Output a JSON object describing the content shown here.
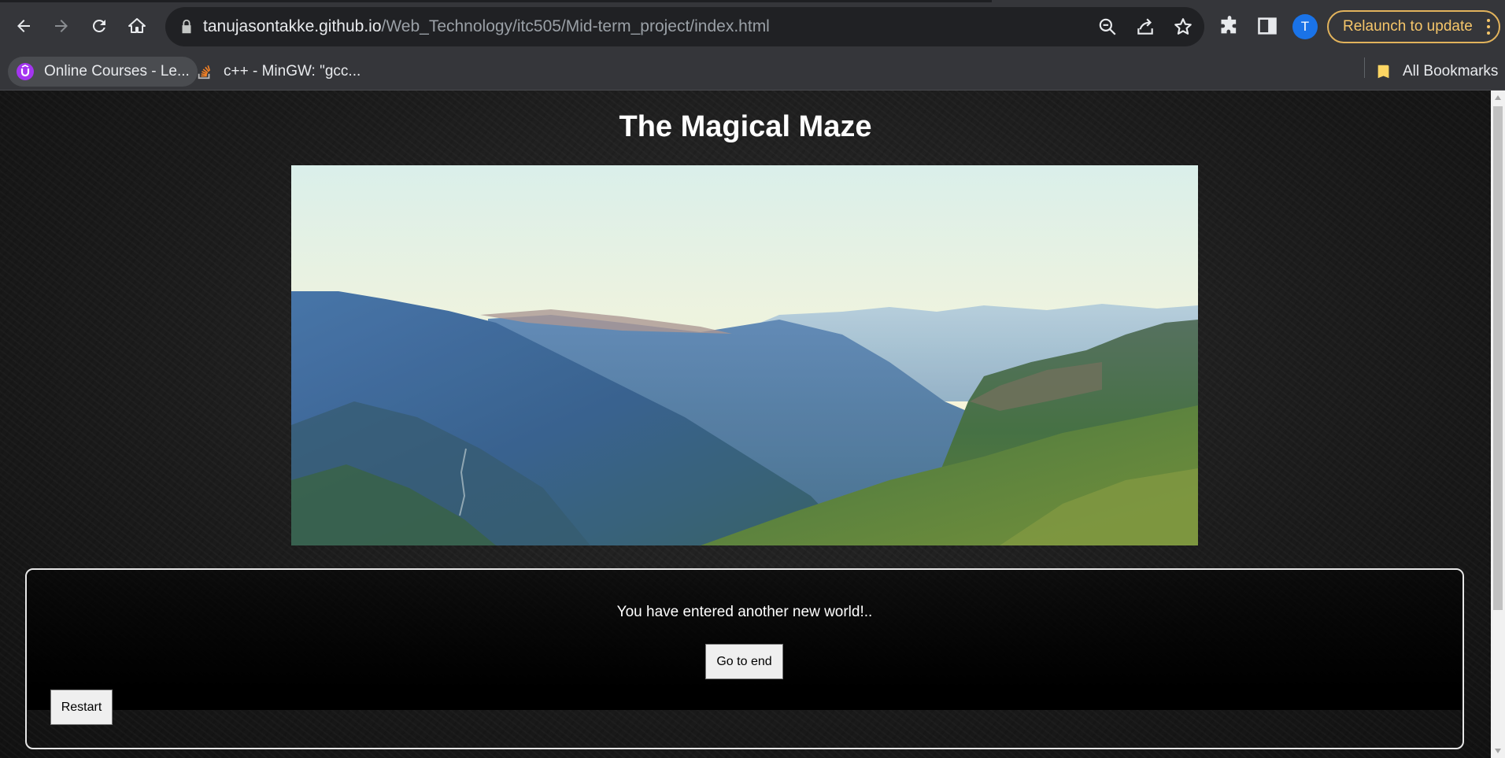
{
  "browser": {
    "url_host": "tanujasontakke.github.io",
    "url_path": "/Web_Technology/itc505/Mid-term_project/index.html",
    "relaunch_label": "Relaunch to update",
    "profile_initial": "T",
    "bookmarks": [
      {
        "label": "Online Courses - Le...",
        "icon": "udemy-icon"
      },
      {
        "label": "c++ - MinGW: \"gcc...",
        "icon": "stackoverflow-icon"
      }
    ],
    "all_bookmarks_label": "All Bookmarks"
  },
  "page": {
    "title": "The Magical Maze",
    "scene_image": "mountain-valley-landscape",
    "story_text": "You have entered another new world!..",
    "go_to_end_label": "Go to end",
    "restart_label": "Restart"
  }
}
